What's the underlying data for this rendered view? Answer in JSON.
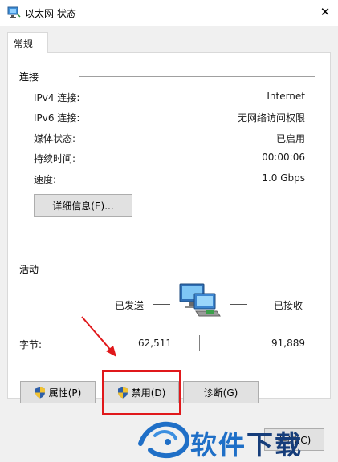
{
  "window": {
    "title": "以太网 状态",
    "close_symbol": "✕"
  },
  "tab": {
    "label": "常规"
  },
  "connection": {
    "group_label": "连接",
    "rows": [
      {
        "label": "IPv4 连接:",
        "value": "Internet"
      },
      {
        "label": "IPv6 连接:",
        "value": "无网络访问权限"
      },
      {
        "label": "媒体状态:",
        "value": "已启用"
      },
      {
        "label": "持续时间:",
        "value": "00:00:06"
      },
      {
        "label": "速度:",
        "value": "1.0 Gbps"
      }
    ],
    "details_button": "详细信息(E)..."
  },
  "activity": {
    "group_label": "活动",
    "sent_label": "已发送",
    "received_label": "已接收",
    "bytes_label": "字节:",
    "bytes_sent": "62,511",
    "bytes_received": "91,889"
  },
  "buttons": {
    "properties": "属性(P)",
    "disable": "禁用(D)",
    "diagnose": "诊断(G)",
    "close": "关闭(C)"
  },
  "watermark": {
    "text_blue": "软件",
    "text_dark": "下载"
  },
  "colors": {
    "highlight_red": "#e0181b",
    "watermark_blue": "#1f6fc7",
    "watermark_dark": "#163d7a"
  }
}
